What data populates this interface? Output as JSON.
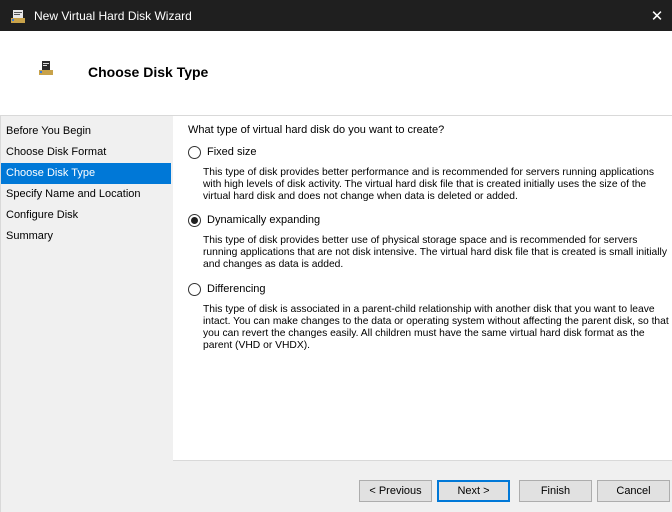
{
  "window": {
    "title": "New Virtual Hard Disk Wizard",
    "close_glyph": "✕"
  },
  "header": {
    "title": "Choose Disk Type"
  },
  "sidebar": {
    "items": [
      {
        "label": "Before You Begin",
        "active": false
      },
      {
        "label": "Choose Disk Format",
        "active": false
      },
      {
        "label": "Choose Disk Type",
        "active": true
      },
      {
        "label": "Specify Name and Location",
        "active": false
      },
      {
        "label": "Configure Disk",
        "active": false
      },
      {
        "label": "Summary",
        "active": false
      }
    ]
  },
  "main": {
    "question": "What type of virtual hard disk do you want to create?",
    "options": [
      {
        "label": "Fixed size",
        "checked": false,
        "description": "This type of disk provides better performance and is recommended for servers running applications with high levels of disk activity. The virtual hard disk file that is created initially uses the size of the virtual hard disk and does not change when data is deleted or added."
      },
      {
        "label": "Dynamically expanding",
        "checked": true,
        "description": "This type of disk provides better use of physical storage space and is recommended for servers running applications that are not disk intensive. The virtual hard disk file that is created is small initially and changes as data is added."
      },
      {
        "label": "Differencing",
        "checked": false,
        "description": "This type of disk is associated in a parent-child relationship with another disk that you want to leave intact. You can make changes to the data or operating system without affecting the parent disk, so that you can revert the changes easily. All children must have the same virtual hard disk format as the parent (VHD or VHDX)."
      }
    ]
  },
  "footer": {
    "previous": "< Previous",
    "next": "Next >",
    "finish": "Finish",
    "cancel": "Cancel"
  },
  "colors": {
    "titlebar": "#1f1f1f",
    "accent": "#0078d7",
    "panel": "#f0f0f0"
  },
  "icons": {
    "app": "virtual-disk-wizard-icon",
    "header": "virtual-disk-icon",
    "close": "close-icon"
  }
}
